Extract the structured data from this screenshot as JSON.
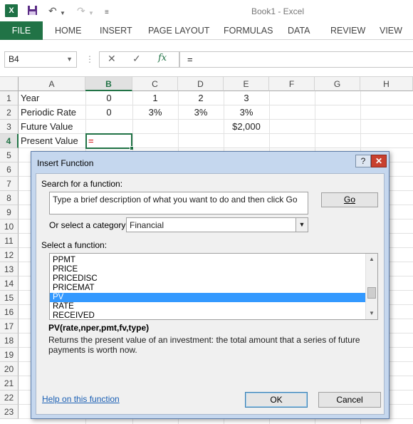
{
  "window": {
    "title": "Book1 - Excel"
  },
  "quick_access": {
    "save_icon": "save-icon",
    "undo_icon": "undo-icon",
    "redo_icon": "redo-icon"
  },
  "ribbon": {
    "tabs": [
      "FILE",
      "HOME",
      "INSERT",
      "PAGE LAYOUT",
      "FORMULAS",
      "DATA",
      "REVIEW",
      "VIEW"
    ],
    "accent": "#217346"
  },
  "formula_bar": {
    "name_box": "B4",
    "fx": "fx",
    "value": "="
  },
  "sheet": {
    "columns": [
      "A",
      "B",
      "C",
      "D",
      "E",
      "F",
      "G",
      "H"
    ],
    "rows": [
      "1",
      "2",
      "3",
      "4",
      "5",
      "6",
      "7",
      "8",
      "9",
      "10",
      "11",
      "12",
      "13",
      "14",
      "15",
      "16",
      "17",
      "18",
      "19",
      "20",
      "21",
      "22",
      "23"
    ],
    "cells": {
      "A1": "Year",
      "B1": "0",
      "C1": "1",
      "D1": "2",
      "E1": "3",
      "A2": "Periodic Rate",
      "B2": "0",
      "C2": "3%",
      "D2": "3%",
      "E2": "3%",
      "A3": "Future Value",
      "E3": "$2,000",
      "A4": "Present Value",
      "B4": "="
    },
    "active_cell": "B4"
  },
  "dialog": {
    "title": "Insert Function",
    "help_button": "?",
    "close_button": "✕",
    "search_label": "Search for a function:",
    "search_value": "Type a brief description of what you want to do and then click Go",
    "go_button": "Go",
    "category_label": "Or select a category:",
    "category_value": "Financial",
    "list_label": "Select a function:",
    "functions": [
      "PPMT",
      "PRICE",
      "PRICEDISC",
      "PRICEMAT",
      "PV",
      "RATE",
      "RECEIVED"
    ],
    "selected_function": "PV",
    "syntax": "PV(rate,nper,pmt,fv,type)",
    "description": "Returns the present value of an investment: the total amount that a series of future payments is worth now.",
    "help_link": "Help on this function",
    "ok_button": "OK",
    "cancel_button": "Cancel"
  }
}
